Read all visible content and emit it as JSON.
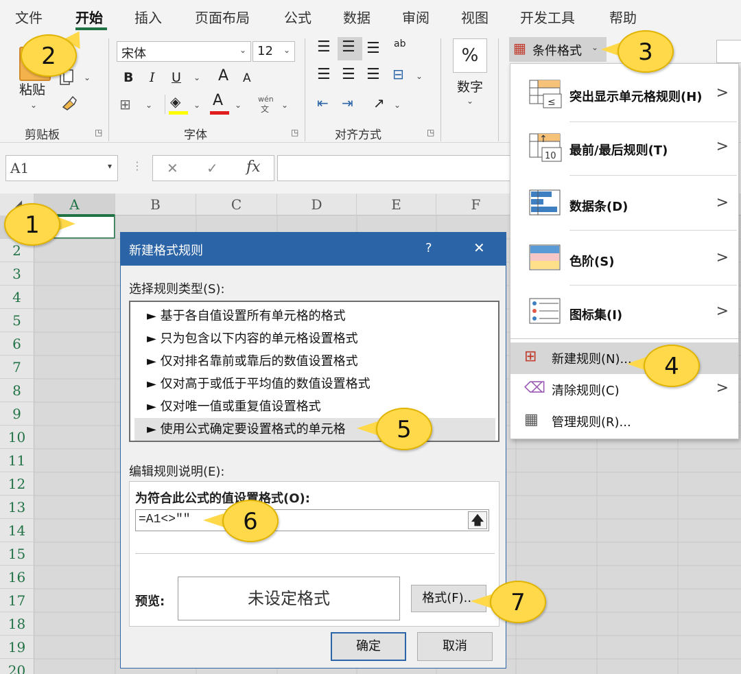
{
  "ribbon": {
    "tabs": [
      "文件",
      "开始",
      "插入",
      "页面布局",
      "公式",
      "数据",
      "审阅",
      "视图",
      "开发工具",
      "帮助"
    ],
    "active_tab": "开始",
    "clipboard": {
      "paste": "粘贴",
      "label": "剪贴板"
    },
    "font": {
      "name": "宋体",
      "size": "12",
      "label": "字体",
      "bold": "B",
      "italic": "I",
      "underline": "U",
      "grow": "A",
      "shrink": "A",
      "phonetic_top": "wén",
      "phonetic_bottom": "文"
    },
    "alignment": {
      "label": "对齐方式"
    },
    "number": {
      "symbol": "%",
      "label": "数字"
    },
    "conditional_format": "条件格式"
  },
  "formula_bar": {
    "name_box": "A1",
    "cancel": "✕",
    "enter": "✓",
    "fx": "fx",
    "value": ""
  },
  "grid": {
    "columns": [
      "A",
      "B",
      "C",
      "D",
      "E",
      "F"
    ],
    "rows": [
      "1",
      "2",
      "3",
      "4",
      "5",
      "6",
      "7",
      "8",
      "9",
      "10",
      "11",
      "12",
      "13",
      "14",
      "15",
      "16",
      "17",
      "18",
      "19",
      "20"
    ]
  },
  "dialog": {
    "title": "新建格式规则",
    "help": "?",
    "close": "✕",
    "rule_type_label": "选择规则类型(S):",
    "rule_types": [
      "► 基于各自值设置所有单元格的格式",
      "► 只为包含以下内容的单元格设置格式",
      "► 仅对排名靠前或靠后的数值设置格式",
      "► 仅对高于或低于平均值的数值设置格式",
      "► 仅对唯一值或重复值设置格式",
      "► 使用公式确定要设置格式的单元格"
    ],
    "selected_rule": 5,
    "edit_label": "编辑规则说明(E):",
    "formula_label": "为符合此公式的值设置格式(O):",
    "formula_value": "=A1<>\"\"",
    "collapse_icon": "🡅",
    "preview_label": "预览:",
    "preview_text": "未设定格式",
    "format_button": "格式(F)...",
    "ok": "确定",
    "cancel": "取消"
  },
  "menu": {
    "items": [
      {
        "label": "突出显示单元格规则(H)",
        "icon": "highlight-rules-icon",
        "submenu": true
      },
      {
        "label": "最前/最后规则(T)",
        "icon": "top-bottom-rules-icon",
        "submenu": true
      },
      {
        "label": "数据条(D)",
        "icon": "data-bars-icon",
        "submenu": true
      },
      {
        "label": "色阶(S)",
        "icon": "color-scales-icon",
        "submenu": true
      },
      {
        "label": "图标集(I)",
        "icon": "icon-sets-icon",
        "submenu": true
      }
    ],
    "actions": [
      {
        "label": "新建规则(N)...",
        "icon": "new-rule-icon",
        "submenu": false
      },
      {
        "label": "清除规则(C)",
        "icon": "clear-rules-icon",
        "submenu": true
      },
      {
        "label": "管理规则(R)...",
        "icon": "manage-rules-icon",
        "submenu": false
      }
    ],
    "chevron": ">"
  },
  "callouts": [
    "1",
    "2",
    "3",
    "4",
    "5",
    "6",
    "7"
  ],
  "colors": {
    "excel_green": "#217346",
    "dialog_blue": "#2b64a7",
    "callout_yellow": "#ffd94a"
  }
}
